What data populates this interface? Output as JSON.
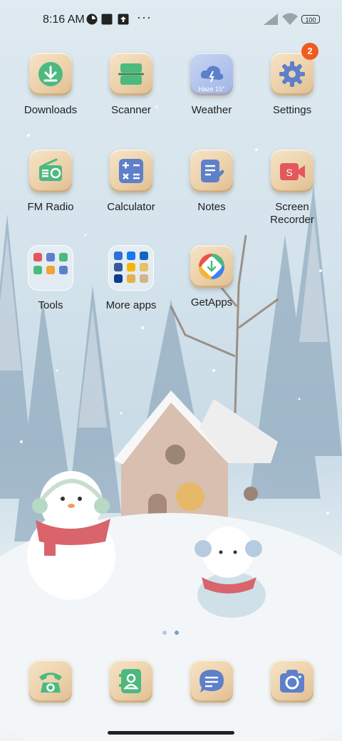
{
  "status_bar": {
    "time": "8:16 AM",
    "battery": "100",
    "overflow": "···",
    "icons": [
      "app-notification-icon",
      "square-notification-icon",
      "upload-notification-icon",
      "signal-icon",
      "wifi-icon",
      "battery-icon"
    ]
  },
  "apps": [
    {
      "label": "Downloads",
      "icon": "download-icon"
    },
    {
      "label": "Scanner",
      "icon": "scanner-icon"
    },
    {
      "label": "Weather",
      "icon": "weather-icon",
      "weather_text": "Haze 15°"
    },
    {
      "label": "Settings",
      "icon": "gear-icon",
      "badge": "2"
    },
    {
      "label": "FM Radio",
      "icon": "radio-icon"
    },
    {
      "label": "Calculator",
      "icon": "calculator-icon"
    },
    {
      "label": "Notes",
      "icon": "notes-icon"
    },
    {
      "label": "Screen Recorder",
      "label_line1": "Screen",
      "label_line2": "Recorder",
      "icon": "screen-recorder-icon"
    },
    {
      "label": "Tools",
      "icon": "folder-icon"
    },
    {
      "label": "More apps",
      "icon": "folder-icon"
    },
    {
      "label": "GetApps",
      "icon": "getapps-icon"
    }
  ],
  "dock": [
    {
      "icon": "phone-icon"
    },
    {
      "icon": "contacts-icon"
    },
    {
      "icon": "messages-icon"
    },
    {
      "icon": "camera-icon"
    }
  ],
  "pager": {
    "pages": 2,
    "current": 2
  },
  "colors": {
    "badge": "#f25a1e",
    "green": "#4cb97f",
    "blue": "#5e7fc9",
    "red": "#e4575c"
  }
}
